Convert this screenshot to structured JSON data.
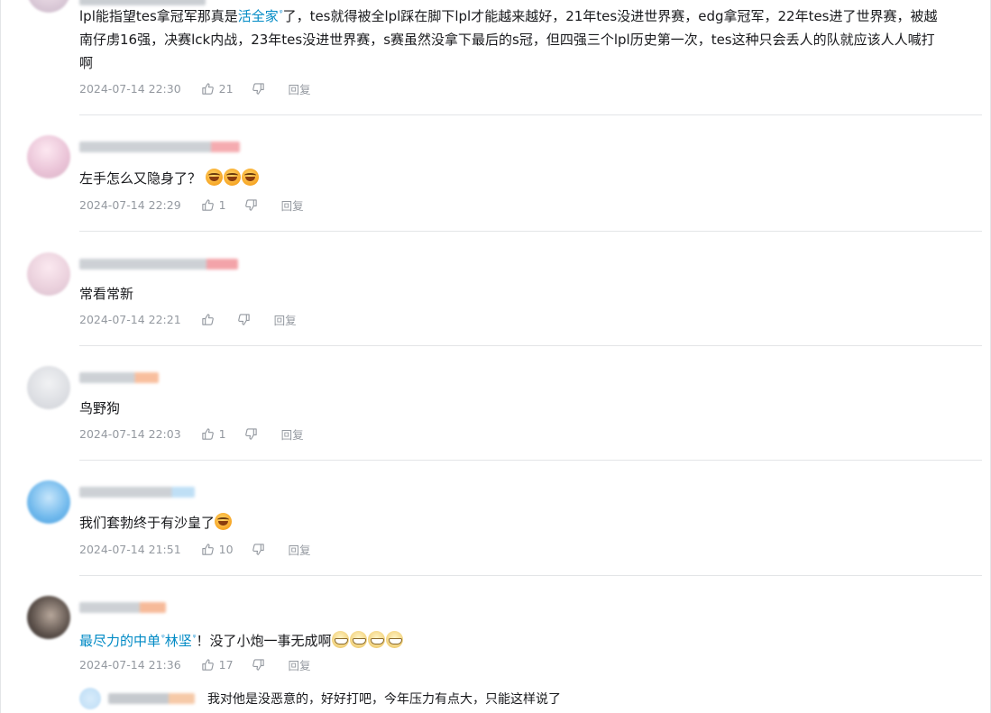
{
  "comments": [
    {
      "text_prefix": "lpl能指望tes拿冠军那真是",
      "link": "活全家",
      "text_rest_line1": "了，tes就得被全lpl踩在脚下lpl才能越来越好，21年tes没进世界赛，edg拿冠军，22年tes进了世界赛，被越",
      "text_line2": "南仔虏16强，决赛lck内战，23年tes没进世界赛，s赛虽然没拿下最后的s冠，但四强三个lpl历史第一次，tes这种只会丢人的队就应该人人喊打",
      "text_line3": "啊",
      "time": "2024-07-14 22:30",
      "likes": "21",
      "reply": "回复"
    },
    {
      "text": "左手怎么又隐身了？",
      "time": "2024-07-14 22:29",
      "likes": "1",
      "reply": "回复"
    },
    {
      "text": "常看常新",
      "time": "2024-07-14 22:21",
      "likes": "",
      "reply": "回复"
    },
    {
      "text": "鸟野狗",
      "time": "2024-07-14 22:03",
      "likes": "1",
      "reply": "回复"
    },
    {
      "text": "我们套勃终于有沙皇了",
      "time": "2024-07-14 21:51",
      "likes": "10",
      "reply": "回复"
    },
    {
      "link1": "最尽力的中单",
      "link2": "林坚",
      "text": "！没了小炮一事无成啊",
      "time": "2024-07-14 21:36",
      "likes": "17",
      "reply": "回复"
    }
  ],
  "sub_reply": {
    "text": "我对他是没恶意的，好好打吧，今年压力有点大，只能这样说了"
  },
  "icons": {
    "like": "thumbs-up-icon",
    "dislike": "thumbs-down-icon",
    "search_sup": "search-icon"
  },
  "colors": {
    "link": "#008ac5",
    "meta": "#9499a0",
    "divider": "#e3e5e7",
    "text": "#18191c"
  }
}
